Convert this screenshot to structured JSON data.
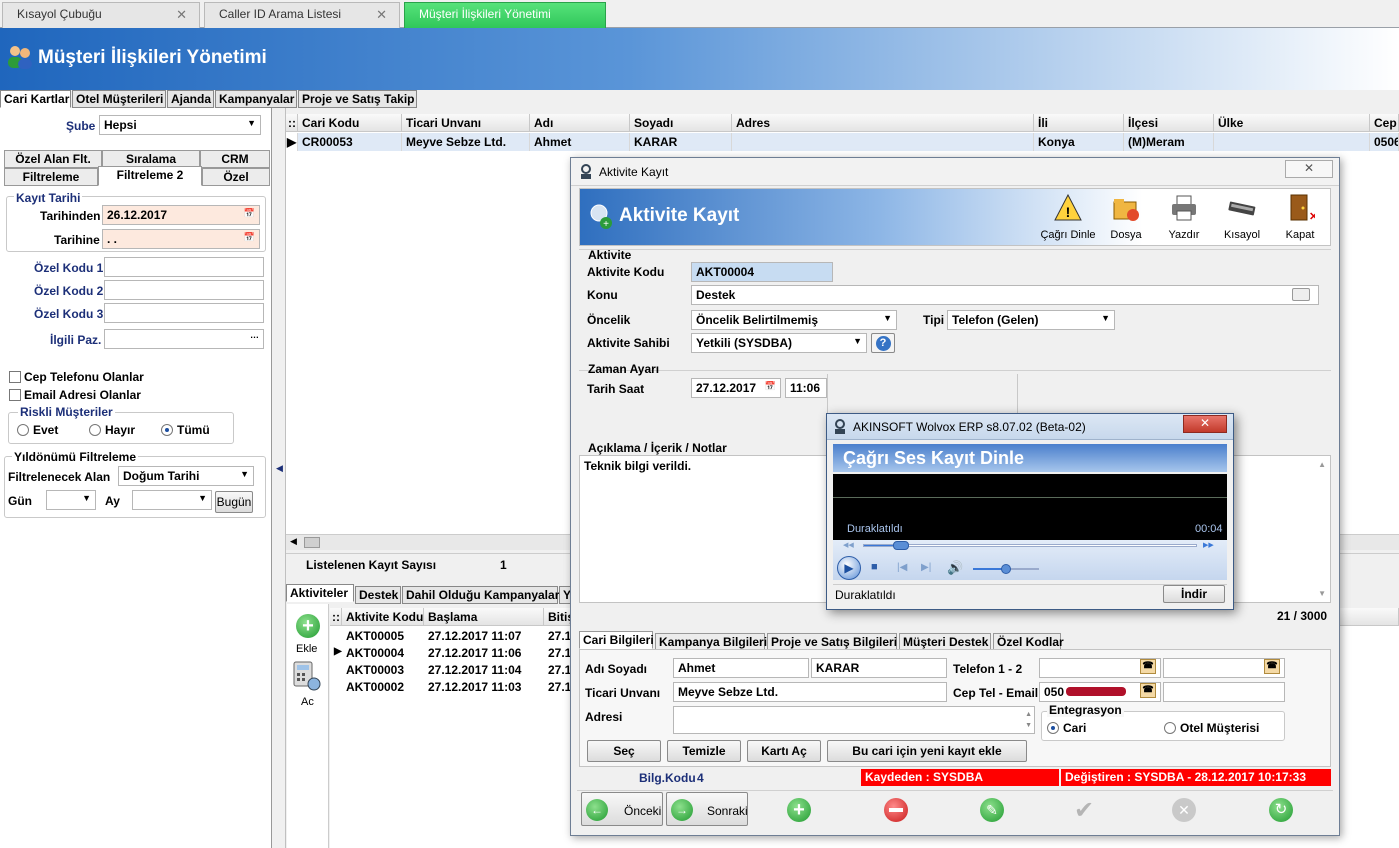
{
  "doc_tabs": [
    {
      "label": "Kısayol Çubuğu"
    },
    {
      "label": "Caller ID Arama Listesi"
    },
    {
      "label": "Müşteri İlişkileri Yönetimi"
    }
  ],
  "header": {
    "title": "Müşteri İlişkileri Yönetimi"
  },
  "module_tabs": [
    "Cari Kartlar",
    "Otel Müşterileri",
    "Ajanda",
    "Kampanyalar",
    "Proje ve Satış Takip"
  ],
  "filter": {
    "sube_label": "Şube",
    "sube_value": "Hepsi",
    "tabs_row1": [
      "Özel Alan Flt.",
      "Sıralama",
      "CRM"
    ],
    "tabs_row2": [
      "Filtreleme",
      "Filtreleme 2",
      "Özel"
    ],
    "kayit_tarihi_label": "Kayıt Tarihi",
    "tarihinden_label": "Tarihinden",
    "tarihinden_value": "26.12.2017",
    "tarihine_label": "Tarihine",
    "tarihine_value": ". .",
    "ozel_kodu_1": "Özel Kodu 1",
    "ozel_kodu_2": "Özel Kodu 2",
    "ozel_kodu_3": "Özel Kodu 3",
    "ilgili_paz": "İlgili Paz.",
    "cep_telefonu": "Cep Telefonu Olanlar",
    "email_adresi": "Email Adresi Olanlar",
    "riskli_label": "Riskli Müşteriler",
    "riskli_options": [
      "Evet",
      "Hayır",
      "Tümü"
    ],
    "riskli_selected": "Tümü",
    "yildonumu_label": "Yıldönümü Filtreleme",
    "filtrelenecek_label": "Filtrelenecek Alan",
    "filtrelenecek_value": "Doğum Tarihi",
    "gun_label": "Gün",
    "ay_label": "Ay",
    "bugun_button": "Bugün"
  },
  "main_grid": {
    "columns": [
      "Cari Kodu",
      "Ticari Unvanı",
      "Adı",
      "Soyadı",
      "Adres",
      "İli",
      "İlçesi",
      "Ülke",
      "Cep ..."
    ],
    "rows": [
      [
        "CR00053",
        "Meyve Sebze Ltd.",
        "Ahmet",
        "KARAR",
        "",
        "Konya",
        "(M)Meram",
        "",
        "0506"
      ]
    ],
    "count_label": "Listelenen Kayıt Sayısı",
    "count_value": "1"
  },
  "bottom_tabs": [
    "Aktiviteler",
    "Destek",
    "Dahil Olduğu Kampanyalar",
    "Y"
  ],
  "side_actions": {
    "add": "Ekle",
    "open": "Ac"
  },
  "activities": {
    "columns": [
      "Aktivite Kodu",
      "Başlama",
      "Bitiş"
    ],
    "rows": [
      [
        "AKT00005",
        "27.12.2017 11:07",
        "27.1"
      ],
      [
        "AKT00004",
        "27.12.2017 11:06",
        "27.1"
      ],
      [
        "AKT00003",
        "27.12.2017 11:04",
        "27.1"
      ],
      [
        "AKT00002",
        "27.12.2017 11:03",
        "27.1"
      ]
    ]
  },
  "dialog": {
    "title": "Aktivite Kayıt",
    "banner_title": "Aktivite Kayıt",
    "toolbar": [
      "Çağrı Dinle",
      "Dosya",
      "Yazdır",
      "Kısayol",
      "Kapat"
    ],
    "section_aktivite": "Aktivite",
    "aktivite_kodu_label": "Aktivite Kodu",
    "aktivite_kodu_value": "AKT00004",
    "konu_label": "Konu",
    "konu_value": "Destek",
    "oncelik_label": "Öncelik",
    "oncelik_value": "Öncelik Belirtilmemiş",
    "tipi_label": "Tipi",
    "tipi_value": "Telefon (Gelen)",
    "sahibi_label": "Aktivite Sahibi",
    "sahibi_value": "Yetkili  (SYSDBA)",
    "zaman_label": "Zaman Ayarı",
    "tarih_label": "Tarih Saat",
    "tarih_value": "27.12.2017",
    "saat_value": "11:06",
    "aciklama_label": "Açıklama / İçerik / Notlar",
    "aciklama_value": "Teknik bilgi verildi.",
    "char_count": "21 / 3000",
    "cari_tabs": [
      "Cari Bilgileri",
      "Kampanya Bilgileri",
      "Proje ve Satış Bilgileri",
      "Müşteri Destek",
      "Özel Kodlar"
    ],
    "adi_soyadi_label": "Adı Soyadı",
    "adi_value": "Ahmet",
    "soyadi_value": "KARAR",
    "telefon_label": "Telefon 1 - 2",
    "ticari_label": "Ticari Unvanı",
    "ticari_value": "Meyve Sebze Ltd.",
    "cep_label": "Cep Tel - Email",
    "cep_value": "050",
    "adresi_label": "Adresi",
    "entegrasyon_label": "Entegrasyon",
    "entegrasyon_options": [
      "Cari",
      "Otel Müşterisi"
    ],
    "buttons": [
      "Seç",
      "Temizle",
      "Kartı Aç",
      "Bu cari için yeni kayıt ekle"
    ],
    "bilg_kodu_label": "Bilg.Kodu",
    "bilg_kodu_value": "4",
    "kaydeden": "Kaydeden : SYSDBA",
    "degistiren": "Değiştiren : SYSDBA - 28.12.2017 10:17:33",
    "nav_prev": "Önceki",
    "nav_next": "Sonraki"
  },
  "player": {
    "window_title": "AKINSOFT Wolvox ERP s8.07.02 (Beta-02)",
    "title": "Çağrı Ses Kayıt Dinle",
    "state_overlay": "Duraklatıldı",
    "time": "00:04",
    "status": "Duraklatıldı",
    "download_button": "İndir"
  },
  "colors": {
    "accent": "#1f66bd",
    "active_tab": "#30c75a",
    "status_red": "#ff0000",
    "selection": "#dfe9f6"
  }
}
